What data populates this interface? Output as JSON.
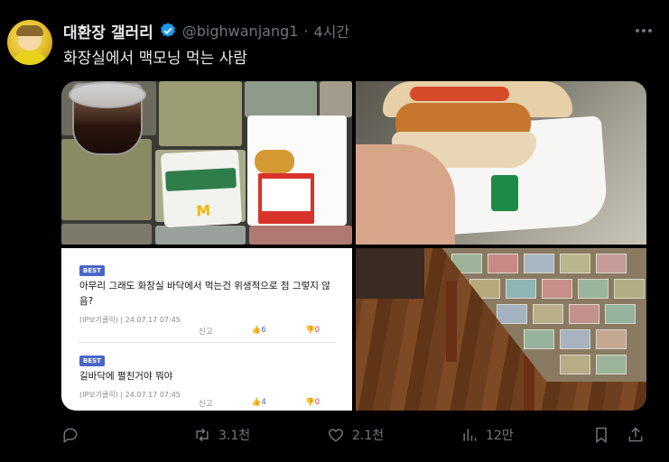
{
  "author": {
    "display_name": "대환장 갤러리",
    "handle": "@bighwanjang1",
    "separator": "·",
    "time": "4시간"
  },
  "tweet": {
    "text": "화장실에서 맥모닝 먹는 사람"
  },
  "media": {
    "comments": [
      {
        "badge": "BEST",
        "text": "아무리 그래도 화장실 바닥에서 먹는건 위생적으로 점 그렇지 않음?",
        "meta": "(IP보기클릭) | 24.07.17 07:45",
        "report": "신고",
        "up": "6",
        "down": "0"
      },
      {
        "badge": "BEST",
        "text": "길바닥에 펼친거야 뭐야",
        "meta": "(IP보기클릭) | 24.07.17 07:45",
        "report": "신고",
        "up": "4",
        "down": "0"
      }
    ]
  },
  "actions": {
    "reply_count": "",
    "retweet_count": "3.1천",
    "like_count": "2.1천",
    "view_count": "12만"
  },
  "colors": {
    "background": "#000000",
    "text": "#e7e9ea",
    "muted": "#71767b",
    "verified": "#1d9bf0"
  }
}
